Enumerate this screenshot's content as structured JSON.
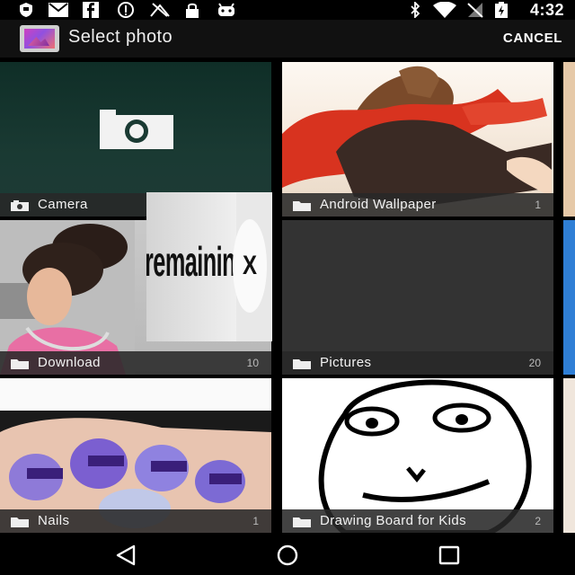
{
  "status_bar": {
    "time": "4:32",
    "icons": [
      "shield-icon",
      "mail-icon",
      "facebook-icon",
      "info-icon",
      "signal-off-icon",
      "lock-icon",
      "android-icon",
      "bluetooth-icon",
      "wifi-icon",
      "no-signal-icon",
      "battery-charging-icon"
    ]
  },
  "action_bar": {
    "title": "Select photo",
    "cancel_label": "CANCEL"
  },
  "albums": [
    {
      "name": "Camera",
      "count": "",
      "icon": "camera-icon"
    },
    {
      "name": "Android Wallpaper",
      "count": "1",
      "icon": "folder-icon"
    },
    {
      "name": "Download",
      "count": "10",
      "icon": "folder-icon"
    },
    {
      "name": "Pictures",
      "count": "20",
      "icon": "folder-icon"
    },
    {
      "name": "Nails",
      "count": "1",
      "icon": "folder-icon"
    },
    {
      "name": "Drawing Board for Kids",
      "count": "2",
      "icon": "folder-icon"
    }
  ],
  "overlay_ad": {
    "text": "remaining",
    "close_glyph": "X"
  },
  "nav_bar": {
    "buttons": [
      "back-icon",
      "home-icon",
      "recents-icon"
    ]
  }
}
